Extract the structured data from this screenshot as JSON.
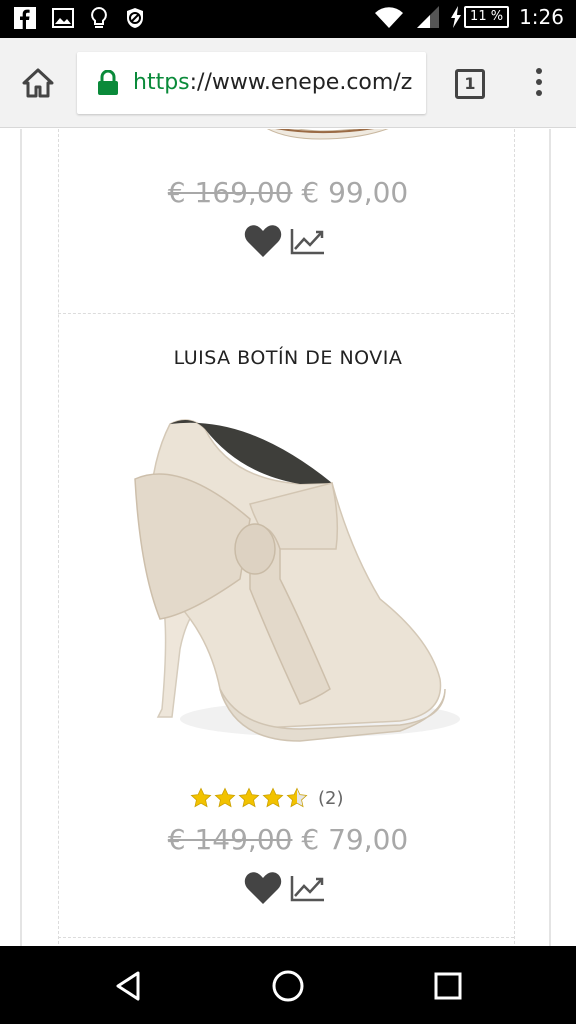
{
  "status_bar": {
    "left_icons": [
      "facebook-icon",
      "image-icon",
      "lightbulb-icon",
      "blocked-icon"
    ],
    "right_icons": [
      "wifi-icon",
      "signal-icon",
      "charging-icon"
    ],
    "battery": "11 %",
    "time": "1:26"
  },
  "browser": {
    "url_scheme": "https",
    "url_rest": "://www.enepe.com/z",
    "tab_count": "1"
  },
  "products": [
    {
      "price_old": "€ 169,00",
      "price_new": "€ 99,00"
    },
    {
      "title": "LUISA BOTÍN DE NOVIA",
      "rating_value": 4.5,
      "rating_max": 5,
      "rating_count": "(2)",
      "price_old": "€ 149,00",
      "price_new": "€ 79,00"
    }
  ],
  "colors": {
    "price": "#a8a8a8",
    "star": "#f2c200",
    "secure": "#0a8a3a"
  }
}
